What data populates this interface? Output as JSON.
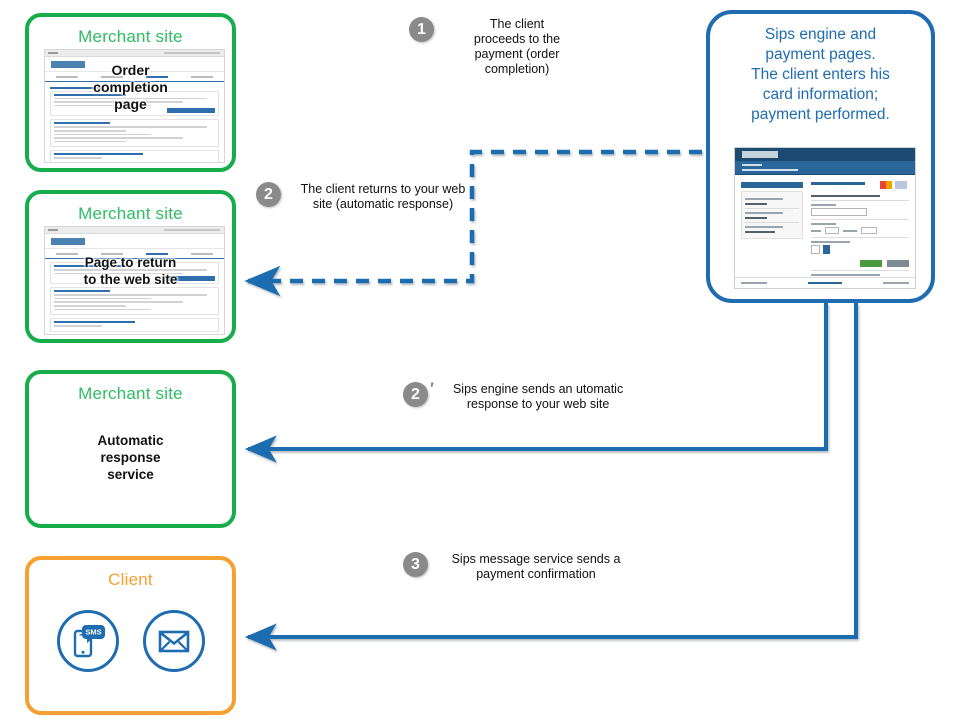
{
  "diagram": {
    "title": "Sips payment flow",
    "colors": {
      "merchant_border": "#18ad4b",
      "merchant_title": "#2fbd62",
      "client_border": "#f5a030",
      "client_title": "#f5a030",
      "sips_border": "#1f6cb0",
      "sips_title": "#1f6cb0",
      "arrow": "#1f6cb0",
      "badge": "#8a8a8a"
    }
  },
  "nodes": {
    "merchant_order": {
      "title": "Merchant site",
      "caption": "Order\ncompletion\npage",
      "caption_lines": [
        "Order",
        "completion",
        "page"
      ]
    },
    "merchant_return": {
      "title": "Merchant site",
      "caption_lines": [
        "Page to return",
        "to the web site"
      ]
    },
    "merchant_auto": {
      "title": "Merchant site",
      "caption_lines": [
        "Automatic",
        "response",
        "service"
      ]
    },
    "client": {
      "title": "Client",
      "icons": [
        "sms-phone-icon",
        "envelope-icon"
      ],
      "sms_label": "SMS"
    },
    "sips": {
      "title_lines": [
        "Sips engine and",
        "payment pages.",
        "The client enters his",
        "card information;",
        "payment performed."
      ],
      "screenshot_name": "worldline-payment-page-screenshot"
    }
  },
  "steps": [
    {
      "number": "1",
      "prime": "",
      "text_lines": [
        "The client",
        "proceeds to the",
        "payment (order",
        "completion)"
      ],
      "arrow_style": "solid",
      "direction": "left-to-right"
    },
    {
      "number": "2",
      "prime": "",
      "text_lines": [
        "The client returns to your web",
        "site (automatic response)"
      ],
      "arrow_style": "dashed",
      "direction": "right-to-left"
    },
    {
      "number": "2",
      "prime": "′",
      "text_lines": [
        "Sips engine sends an utomatic",
        "response to your web site"
      ],
      "arrow_style": "solid",
      "direction": "right-to-left"
    },
    {
      "number": "3",
      "prime": "",
      "text_lines": [
        "Sips message service sends a",
        "payment confirmation"
      ],
      "arrow_style": "solid",
      "direction": "right-to-left"
    }
  ]
}
